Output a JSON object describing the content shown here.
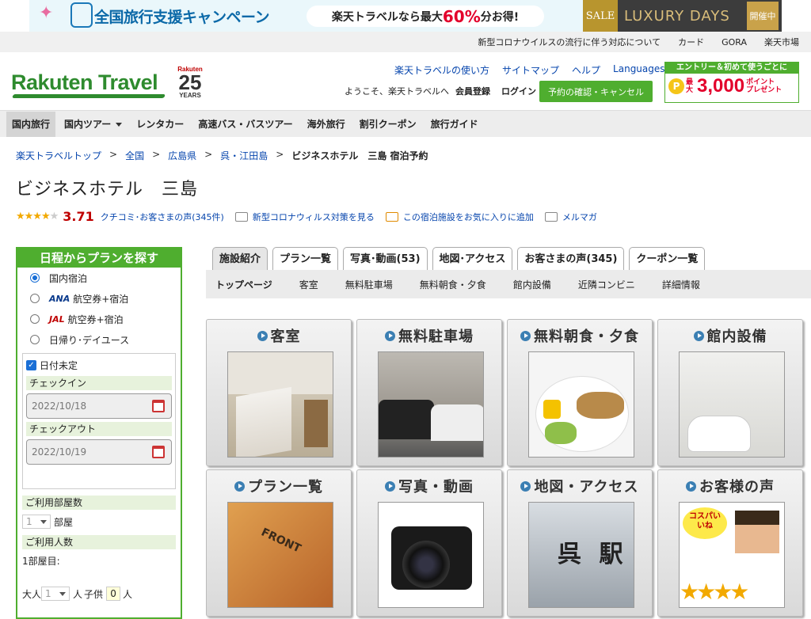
{
  "banner": {
    "campaign": "全国旅行支援キャンペーン",
    "promo_prefix": "楽天トラベルなら最大",
    "promo_pct": "60%",
    "promo_suffix": "分お得!",
    "sale": "SALE",
    "luxury": "LUXURY DAYS",
    "kaisai": "開催中"
  },
  "util": [
    "新型コロナウイルスの流行に伴う対応について",
    "カード",
    "GORA",
    "楽天市場"
  ],
  "header": {
    "logo": "Rakuten Travel",
    "anniv_top": "Rakuten",
    "anniv_num": "25",
    "anniv_bottom": "YEARS",
    "links": [
      "楽天トラベルの使い方",
      "サイトマップ",
      "ヘルプ",
      "Languages"
    ],
    "welcome": "ようこそ、楽天トラベルへ",
    "register": "会員登録",
    "login": "ログイン",
    "reservation": "予約の確認・キャンセル",
    "promo_head": "エントリー＆初めて使うごとに",
    "promo_max": "最大",
    "promo_amount": "3,000",
    "promo_point": "ポイント",
    "promo_present": "プレゼント"
  },
  "nav": [
    "国内旅行",
    "国内ツアー",
    "レンタカー",
    "高速バス・バスツアー",
    "海外旅行",
    "割引クーポン",
    "旅行ガイド"
  ],
  "breadcrumb": [
    "楽天トラベルトップ",
    "全国",
    "広島県",
    "呉・江田島",
    "ビジネスホテル　三島 宿泊予約"
  ],
  "hotel": {
    "title": "ビジネスホテル　三島",
    "rating": "3.71",
    "review_link": "クチコミ･お客さまの声(345件)",
    "covid_link": "新型コロナウィルス対策を見る",
    "fav_link": "この宿泊施設をお気に入りに追加",
    "mail_link": "メルマガ"
  },
  "side": {
    "title": "日程からプランを探す",
    "options": [
      "国内宿泊",
      "航空券+宿泊",
      "航空券+宿泊",
      "日帰り･デイユース"
    ],
    "ana": "ANA",
    "jal": "JAL",
    "undecided": "日付未定",
    "checkin_label": "チェックイン",
    "checkin": "2022/10/18",
    "checkout_label": "チェックアウト",
    "checkout": "2022/10/19",
    "rooms_label": "ご利用部屋数",
    "rooms_value": "1",
    "rooms_unit": "部屋",
    "guests_label": "ご利用人数",
    "room1": "1部屋目:",
    "adult": "大人",
    "adult_value": "1",
    "person": "人",
    "child": "子供",
    "child_value": "0",
    "person2": "人"
  },
  "tabs": [
    "施設紹介",
    "プラン一覧",
    "写真･動画(53)",
    "地図･アクセス",
    "お客さまの声(345)",
    "クーポン一覧"
  ],
  "subnav": [
    "トップページ",
    "客室",
    "無料駐車場",
    "無料朝食・夕食",
    "館内設備",
    "近隣コンビニ",
    "詳細情報"
  ],
  "cards": [
    "客室",
    "無料駐車場",
    "無料朝食・夕食",
    "館内設備",
    "プラン一覧",
    "写真・動画",
    "地図・アクセス",
    "お客様の声"
  ],
  "card_text": {
    "front": "FRONT",
    "station": "呉 駅",
    "voice": "コスパいいね"
  },
  "colors": {
    "green": "#4fae2f",
    "red": "#bf0000",
    "link": "#0645ad"
  }
}
